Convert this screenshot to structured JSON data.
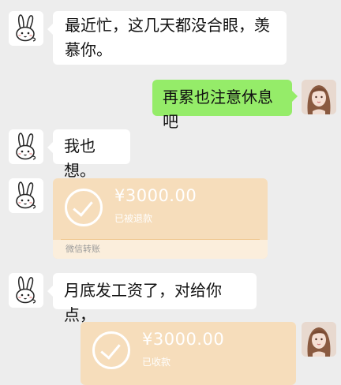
{
  "messages": {
    "m1": {
      "text": "最近忙，这几天都没合眼，羡慕你。"
    },
    "m2": {
      "text": "再累也注意休息吧"
    },
    "m3": {
      "text": "我也想。"
    },
    "m4": {
      "amount": "¥3000.00",
      "status": "已被退款",
      "footer": "微信转账"
    },
    "m5": {
      "text": "月底发工资了，对给你点，"
    },
    "m6": {
      "amount": "¥3000.00",
      "status": "已收款"
    }
  },
  "colors": {
    "background": "#ededed",
    "own_bubble": "#95ec69",
    "transfer_card": "#f6ddbb"
  },
  "icons": {
    "contact_avatar": "rabbit-avatar-icon",
    "own_avatar": "girl-avatar-photo",
    "transfer_status": "check-circle-icon"
  }
}
